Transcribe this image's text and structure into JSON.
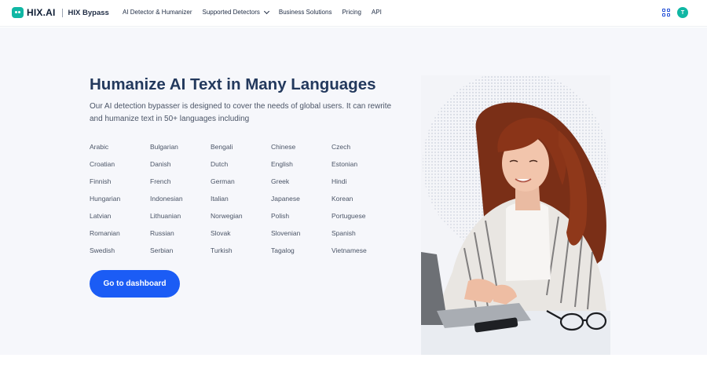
{
  "brand": {
    "logo_text": "HIX.AI",
    "product": "HIX Bypass",
    "accent_color": "#10b7a4"
  },
  "nav": {
    "items": [
      {
        "label": "AI Detector & Humanizer",
        "has_dropdown": false
      },
      {
        "label": "Supported Detectors",
        "has_dropdown": true
      },
      {
        "label": "Business Solutions",
        "has_dropdown": false
      },
      {
        "label": "Pricing",
        "has_dropdown": false
      },
      {
        "label": "API",
        "has_dropdown": false
      }
    ],
    "apps_icon": "grid-apps-icon",
    "avatar_initial": "T"
  },
  "hero": {
    "title": "Humanize AI Text in Many Languages",
    "description": "Our AI detection bypasser is designed to cover the needs of global users. It can rewrite and humanize text in 50+ languages including",
    "languages": [
      "Arabic",
      "Bulgarian",
      "Bengali",
      "Chinese",
      "Czech",
      "Croatian",
      "Danish",
      "Dutch",
      "English",
      "Estonian",
      "Finnish",
      "French",
      "German",
      "Greek",
      "Hindi",
      "Hungarian",
      "Indonesian",
      "Italian",
      "Japanese",
      "Korean",
      "Latvian",
      "Lithuanian",
      "Norwegian",
      "Polish",
      "Portuguese",
      "Romanian",
      "Russian",
      "Slovak",
      "Slovenian",
      "Spanish",
      "Swedish",
      "Serbian",
      "Turkish",
      "Tagalog",
      "Vietnamese"
    ],
    "cta_label": "Go to dashboard",
    "cta_color": "#1b5cf5",
    "image": "woman-typing-on-laptop-with-globe-photo"
  }
}
